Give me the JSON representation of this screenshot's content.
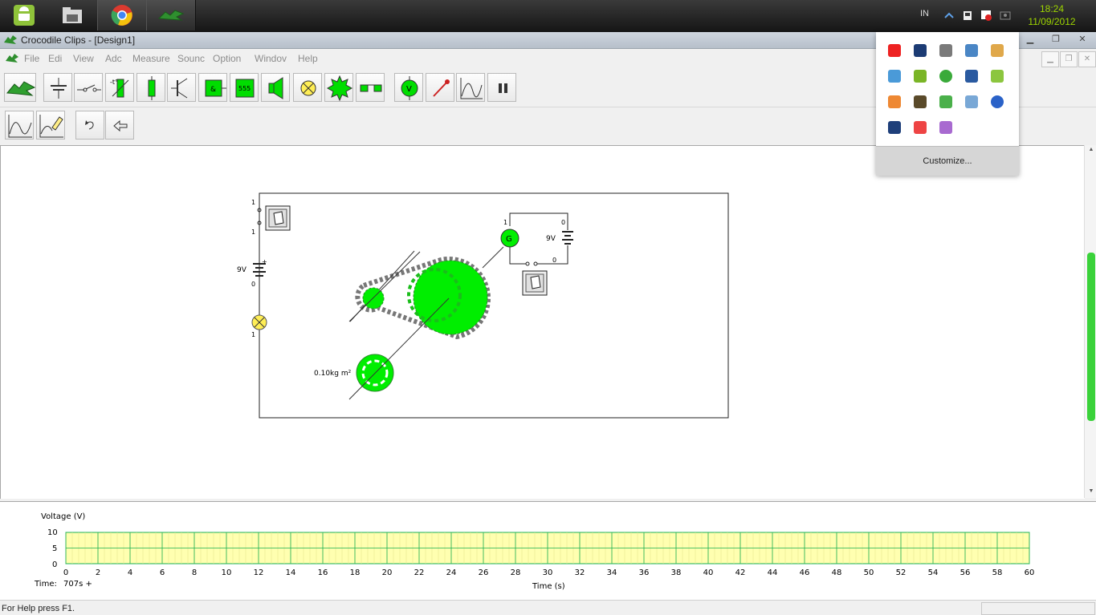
{
  "taskbar": {
    "apps": [
      "android-icon",
      "folder-icon",
      "chrome-icon",
      "crocodile-clips-icon"
    ],
    "lang": "IN",
    "time": "18:24",
    "date": "11/09/2012",
    "clock_color": "#9ed600"
  },
  "window": {
    "title": "Crocodile Clips - [Design1]",
    "menu": [
      "File",
      "Edit",
      "View",
      "Add",
      "Measure",
      "Sound",
      "Options",
      "Window",
      "Help"
    ],
    "menu_visible": [
      "File",
      "Edi",
      "View",
      "Adc",
      "Measure",
      "Sounc",
      "Option",
      "Windov",
      "Help"
    ]
  },
  "toolbar1": [
    "crocodile-logo-icon",
    "capacitor-icon",
    "switch-icon",
    "thermistor-icon",
    "resistor-icon",
    "transistor-icon",
    "logic-gate-icon",
    "ic-555-icon",
    "speaker-icon",
    "lamp-icon",
    "gear-icon",
    "pulley-icon",
    "voltmeter-icon",
    "probe-icon",
    "graph-icon",
    "pause-icon"
  ],
  "toolbar1_labels": {
    "ic555": "555",
    "voltmeter": "V"
  },
  "toolbar2": [
    "graph-icon",
    "edit-graph-icon",
    "undo-icon",
    "back-icon"
  ],
  "circuit": {
    "battery_left": "9V",
    "battery_right": "9V",
    "generator": "G",
    "flywheel_label": "0.10kg m²",
    "node_labels": [
      "1",
      "1",
      "0",
      "1",
      "1",
      "0",
      "0"
    ],
    "accent": "#00ee00"
  },
  "graph": {
    "ylabel": "Voltage (V)",
    "xlabel": "Time (s)",
    "time_label": "Time:",
    "time_value": "707s +",
    "y_ticks": [
      "10",
      "5",
      "0"
    ],
    "x_ticks": [
      "0",
      "2",
      "4",
      "6",
      "8",
      "10",
      "12",
      "14",
      "16",
      "18",
      "20",
      "22",
      "24",
      "26",
      "28",
      "30",
      "32",
      "34",
      "36",
      "38",
      "40",
      "42",
      "44",
      "46",
      "48",
      "50",
      "52",
      "54",
      "56",
      "58",
      "60"
    ],
    "bg_color": "#ffffb0",
    "grid_color": "#18b050"
  },
  "status": {
    "text": "For Help press F1."
  },
  "tray_popup": {
    "icons": [
      "avira-icon",
      "monitor-icon",
      "network-drive-icon",
      "sync-icon",
      "paint-icon",
      "network-icon",
      "eject-icon",
      "globe-icon",
      "display-icon",
      "volume-icon",
      "flash-icon",
      "calculator-icon",
      "flag-icon",
      "update-icon",
      "info-icon",
      "virtualbox-icon",
      "blocked-icon",
      "feather-icon"
    ],
    "customize": "Customize..."
  }
}
